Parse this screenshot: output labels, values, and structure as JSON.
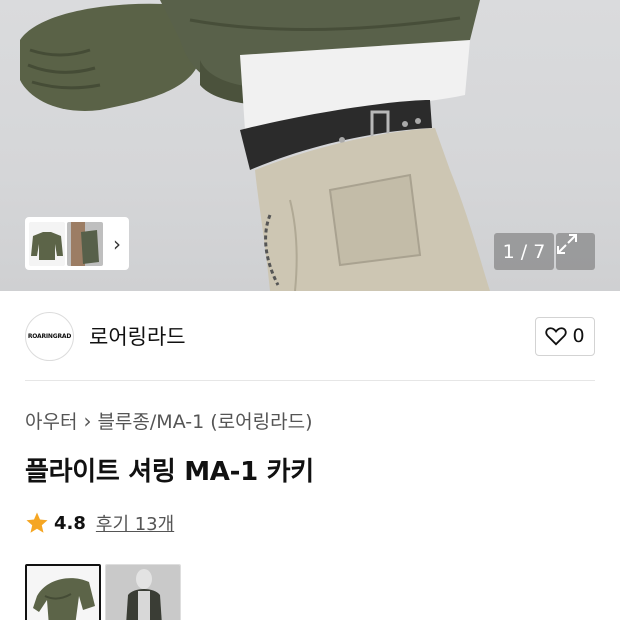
{
  "gallery_counter": "1 / 7",
  "brand": {
    "logo_text": "ROARINGRAD",
    "name": "로어링라드",
    "like_count": "0"
  },
  "breadcrumb": {
    "category": "아우터",
    "subcategory": "블루종/MA-1 (로어링라드)"
  },
  "product": {
    "title": "플라이트 셔링 MA-1 카키",
    "rating": "4.8",
    "reviews_label": "후기 13개"
  },
  "icons": {
    "star": "star-icon",
    "heart": "heart-icon",
    "expand": "expand-icon",
    "chevron": "chevron-right-icon"
  },
  "colors": {
    "star": "#f5a623",
    "jacket": "#5c6448",
    "pants": "#cfc8b6"
  }
}
